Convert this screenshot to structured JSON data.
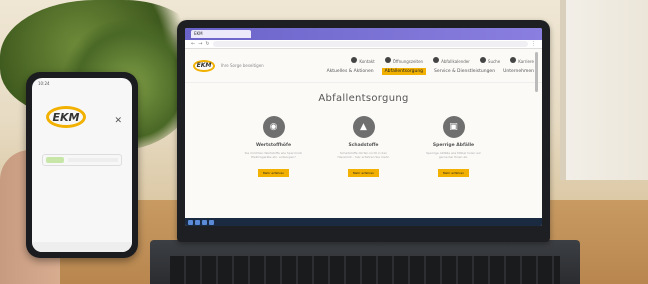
{
  "browser": {
    "tab_label": "EKM",
    "controls": [
      "back-icon",
      "forward-icon",
      "reload-icon",
      "menu-icon"
    ]
  },
  "site": {
    "logo_text": "EKM",
    "tagline": "Ihre Sorge beseitigen",
    "nav_top": [
      "Kontakt",
      "Öffnungszeiten",
      "Abfallkalender",
      "Suche",
      "Karriere"
    ],
    "nav_bottom": [
      "Aktuelles & Aktionen",
      "Abfallentsorgung",
      "Service & Dienstleistungen",
      "Unternehmen"
    ],
    "nav_active_index": 1,
    "hero_title": "Abfallentsorgung",
    "cards": [
      {
        "title": "Wertstoffhöfe",
        "text": "Sie möchten Wertstoffe wie Sperrmüll, Elektrogeräte etc. entsorgen?",
        "button": "Mehr erfahren",
        "icon": "pin-icon"
      },
      {
        "title": "Schadstoffe",
        "text": "Schadstoffe dürfen nicht in den Hausmüll – hier erfahren Sie mehr.",
        "button": "Mehr erfahren",
        "icon": "flask-icon"
      },
      {
        "title": "Sperrige Abfälle",
        "text": "Sperrige Abfälle wie Möbel holen wir gerne bei Ihnen ab.",
        "button": "Mehr erfahren",
        "icon": "sofa-icon"
      }
    ]
  },
  "phone": {
    "status_time": "10:24",
    "logo_text": "EKM"
  },
  "colors": {
    "brand_yellow": "#f2b100",
    "browser_purple": "#7a70d8",
    "laptop_body": "#1d1f22"
  }
}
